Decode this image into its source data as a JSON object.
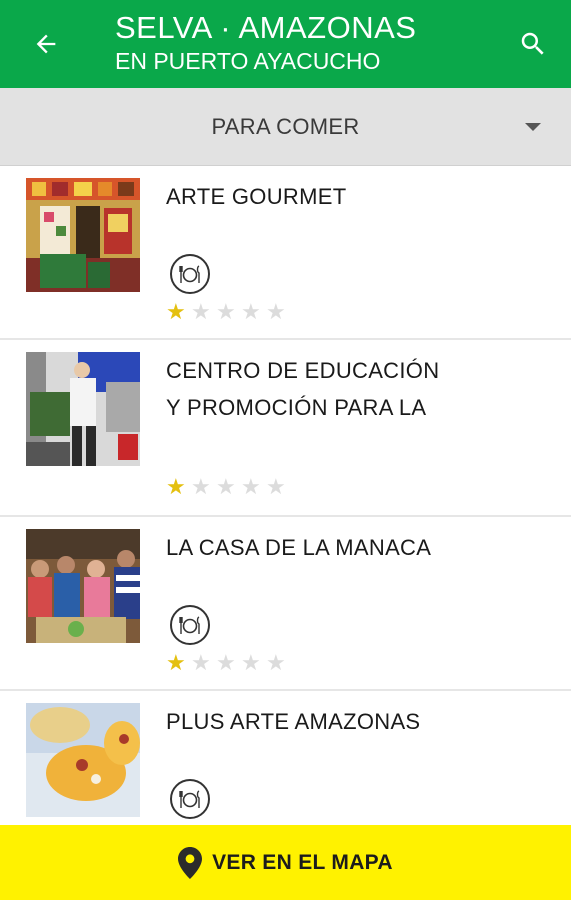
{
  "header": {
    "title": "SELVA · AMAZONAS",
    "subtitle": "EN PUERTO AYACUCHO",
    "back_icon": "arrow-back-icon",
    "search_icon": "search-icon",
    "background": "#0aa84a"
  },
  "filter": {
    "selected": "PARA COMER",
    "dropdown_icon": "caret-down-icon"
  },
  "places": [
    {
      "name_lines": [
        "ARTE GOURMET"
      ],
      "has_category_icon": true,
      "category_icon": "restaurant-icon",
      "rating": 1,
      "max_rating": 5
    },
    {
      "name_lines": [
        "CENTRO DE EDUCACIÓN",
        "Y PROMOCIÓN PARA LA"
      ],
      "has_category_icon": false,
      "rating": 1,
      "max_rating": 5
    },
    {
      "name_lines": [
        "LA CASA DE LA MANACA"
      ],
      "has_category_icon": true,
      "category_icon": "restaurant-icon",
      "rating": 1,
      "max_rating": 5
    },
    {
      "name_lines": [
        "PLUS ARTE AMAZONAS"
      ],
      "has_category_icon": true,
      "category_icon": "restaurant-icon",
      "rating": null,
      "max_rating": 5
    }
  ],
  "map_button": {
    "label": "VER EN EL MAPA",
    "icon": "map-pin-icon",
    "background": "#fff200"
  },
  "colors": {
    "star_active": "#e4c010",
    "star_inactive": "#dcdcdc"
  }
}
